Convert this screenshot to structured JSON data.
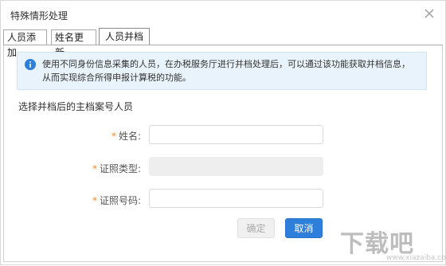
{
  "dialog": {
    "title": "特殊情形处理"
  },
  "tabs": [
    {
      "label": "人员添加"
    },
    {
      "label": "姓名更新"
    },
    {
      "label": "人员并档"
    }
  ],
  "notice": {
    "text": "使用不同身份信息采集的人员，在办税服务厅进行并档处理后，可以通过该功能获取并档信息，从而实现综合所得申报计算税的功能。"
  },
  "section": {
    "title": "选择并档后的主档案号人员"
  },
  "form": {
    "required_mark": "*",
    "name_label": "姓名:",
    "name_value": "",
    "id_type_label": "证照类型:",
    "id_type_value": "",
    "id_number_label": "证照号码:",
    "id_number_value": ""
  },
  "buttons": {
    "ok_label": "确定",
    "cancel_label": "取消"
  },
  "watermark": {
    "text": "下载吧",
    "url": "www.xiazaiba.com"
  },
  "colors": {
    "accent": "#2e7fdc",
    "required": "#f08a24",
    "notice_bg": "#e9f3fc"
  }
}
